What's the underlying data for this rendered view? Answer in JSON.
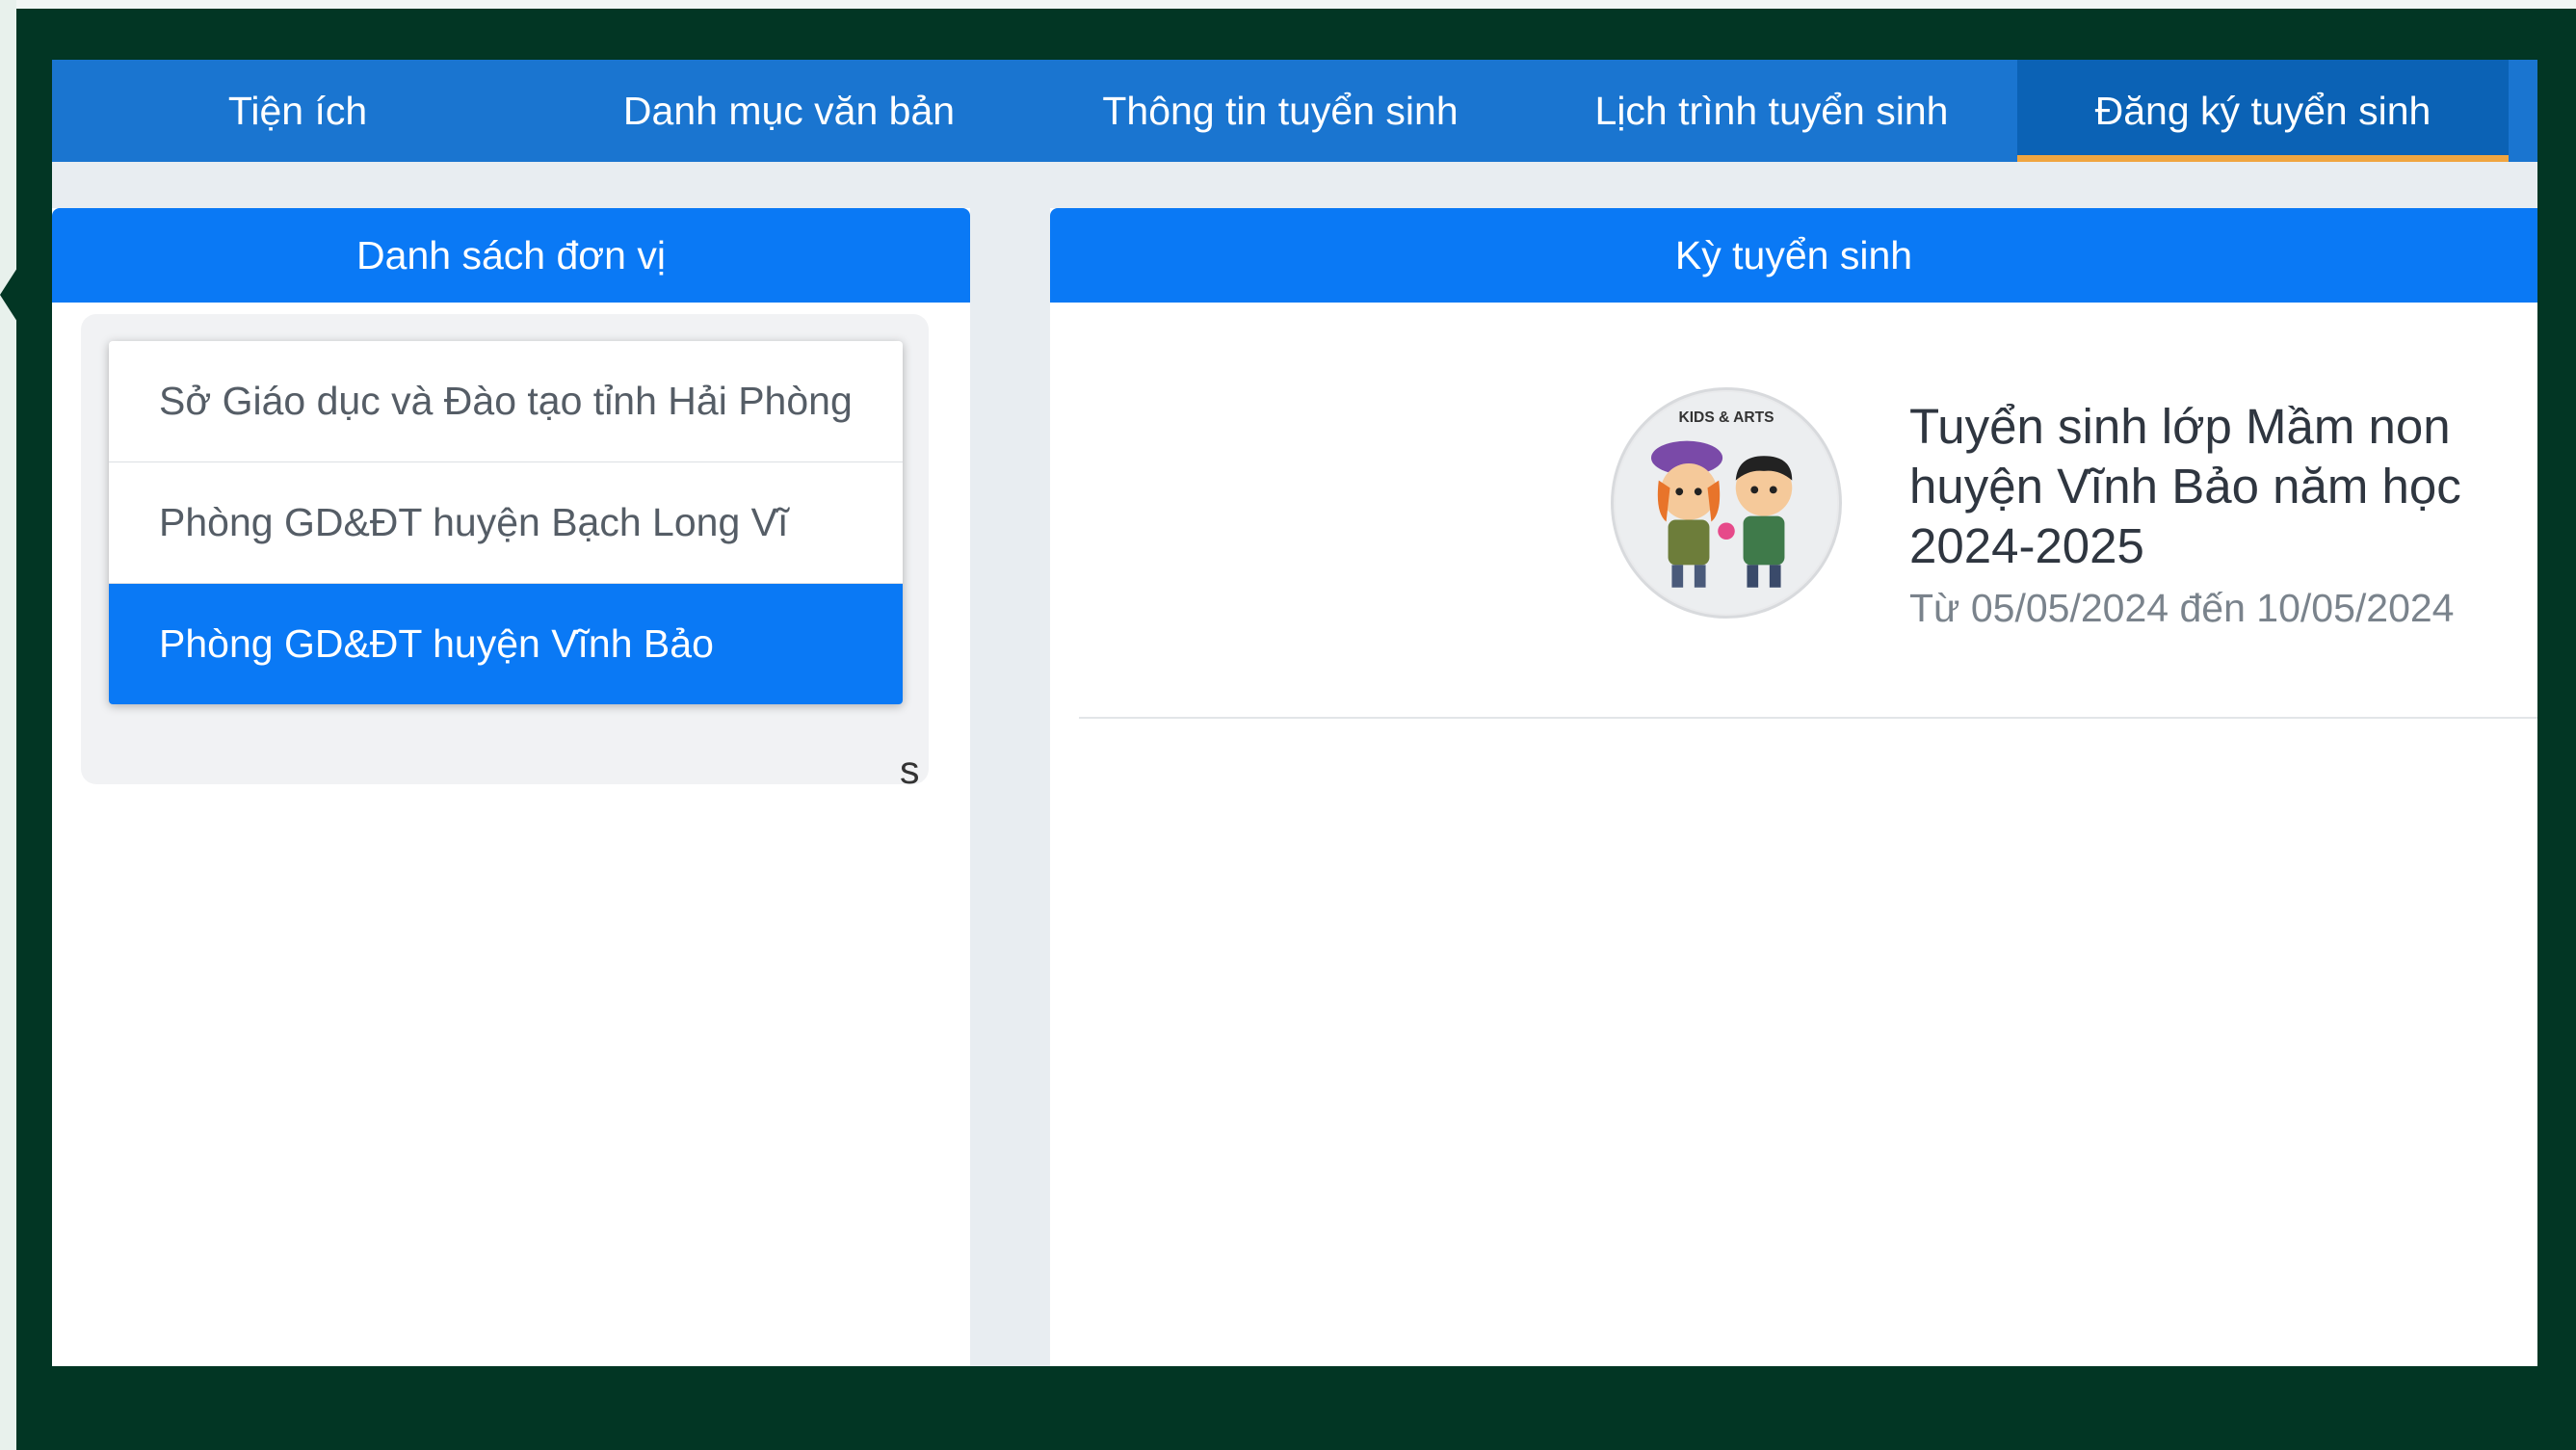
{
  "nav": {
    "items": [
      {
        "label": "Tiện ích"
      },
      {
        "label": "Danh mục văn bản"
      },
      {
        "label": "Thông tin tuyển sinh"
      },
      {
        "label": "Lịch trình tuyển sinh"
      },
      {
        "label": "Đăng ký tuyển sinh"
      }
    ],
    "active_index": 4
  },
  "left_panel": {
    "title": "Danh sách đơn vị",
    "units": [
      {
        "label": "Sở Giáo dục và Đào tạo tỉnh Hải Phòng"
      },
      {
        "label": "Phòng GD&ĐT huyện Bạch Long Vĩ"
      },
      {
        "label": "Phòng GD&ĐT huyện Vĩnh Bảo"
      }
    ],
    "selected_index": 2,
    "stray_text": "s"
  },
  "right_panel": {
    "title": "Kỳ tuyển sinh",
    "card": {
      "image_text": "KIDS & ARTS",
      "title": "Tuyển sinh lớp Mầm non huyện Vĩnh Bảo năm học 2024-2025",
      "date": "Từ 05/05/2024 đến 10/05/2024"
    }
  },
  "colors": {
    "frame": "#023624",
    "nav": "#1a75d0",
    "nav_active": "#0b62b5",
    "active_underline": "#f0a540",
    "header": "#0a79f5"
  }
}
